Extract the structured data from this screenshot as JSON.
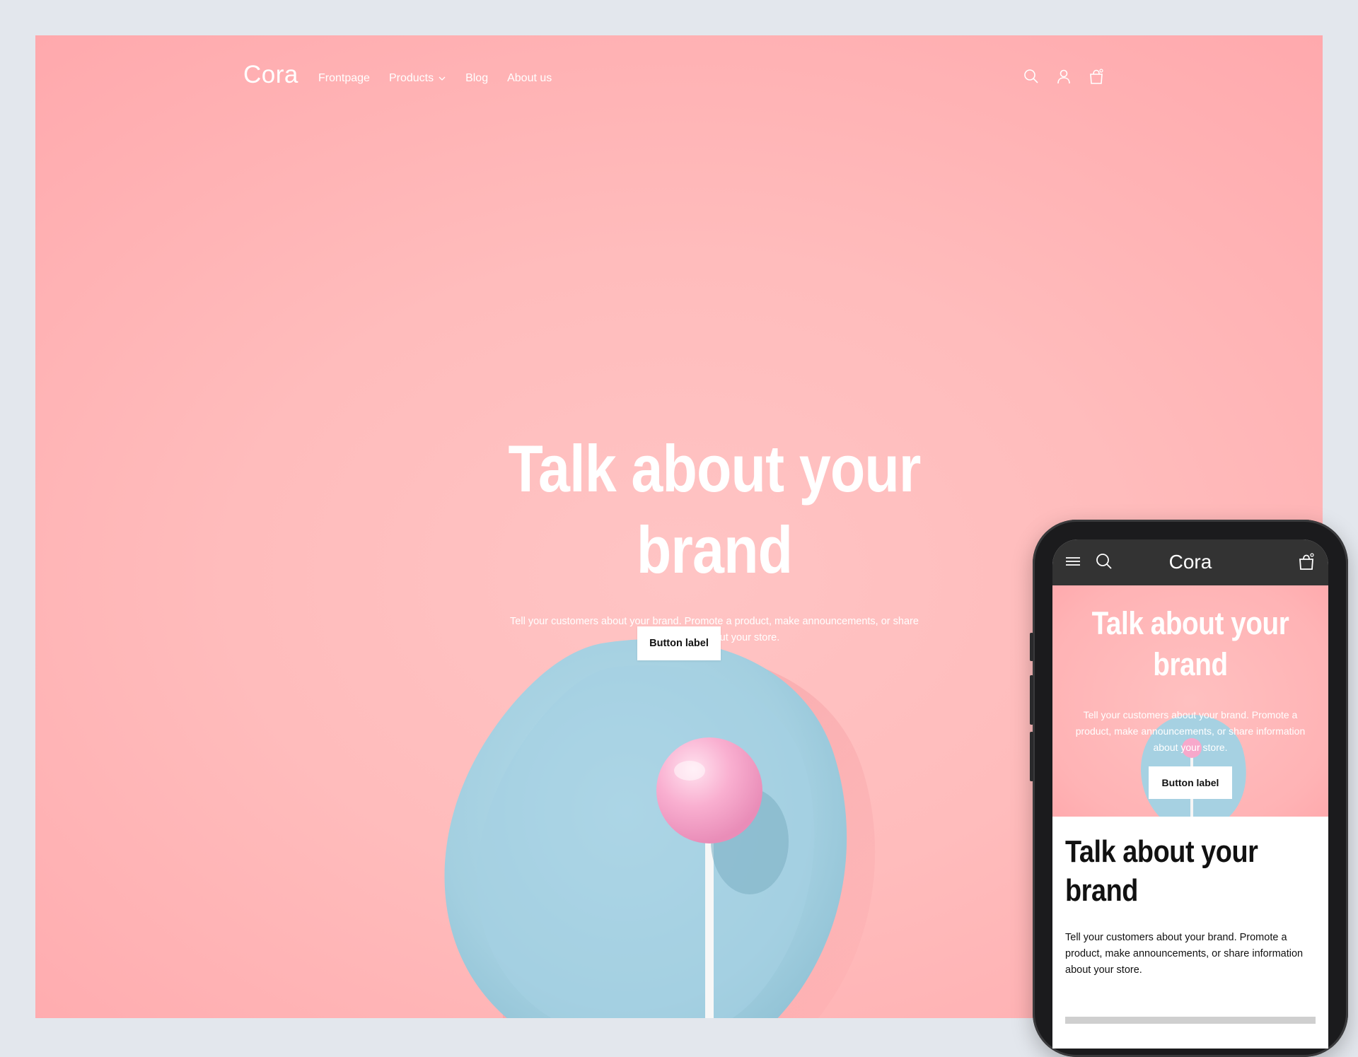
{
  "desktop": {
    "logo": "Cora",
    "nav": [
      {
        "label": "Frontpage"
      },
      {
        "label": "Products",
        "has_dropdown": true
      },
      {
        "label": "Blog"
      },
      {
        "label": "About us"
      }
    ],
    "header_icons": [
      "search-icon",
      "account-icon",
      "cart-icon"
    ],
    "hero": {
      "title": "Talk about your brand",
      "subtitle": "Tell your customers about your brand. Promote a product, make announcements, or share information about your store.",
      "button_label": "Button label"
    }
  },
  "mobile": {
    "logo": "Cora",
    "header_icons": [
      "menu-icon",
      "search-icon",
      "cart-icon"
    ],
    "hero": {
      "title": "Talk about your brand",
      "subtitle": "Tell your customers about your brand. Promote a product, make announcements, or share information about your store.",
      "button_label": "Button label"
    },
    "section": {
      "title": "Talk about your brand",
      "text": "Tell your customers about your brand. Promote a product, make announcements, or share information about your store."
    }
  },
  "colors": {
    "page_bg": "#e3e7ed",
    "hero_pink": "#ffbcbc",
    "plate_blue": "#a8d4e3",
    "lollipop_pink": "#f7a3c8",
    "mobile_header": "#333333"
  }
}
